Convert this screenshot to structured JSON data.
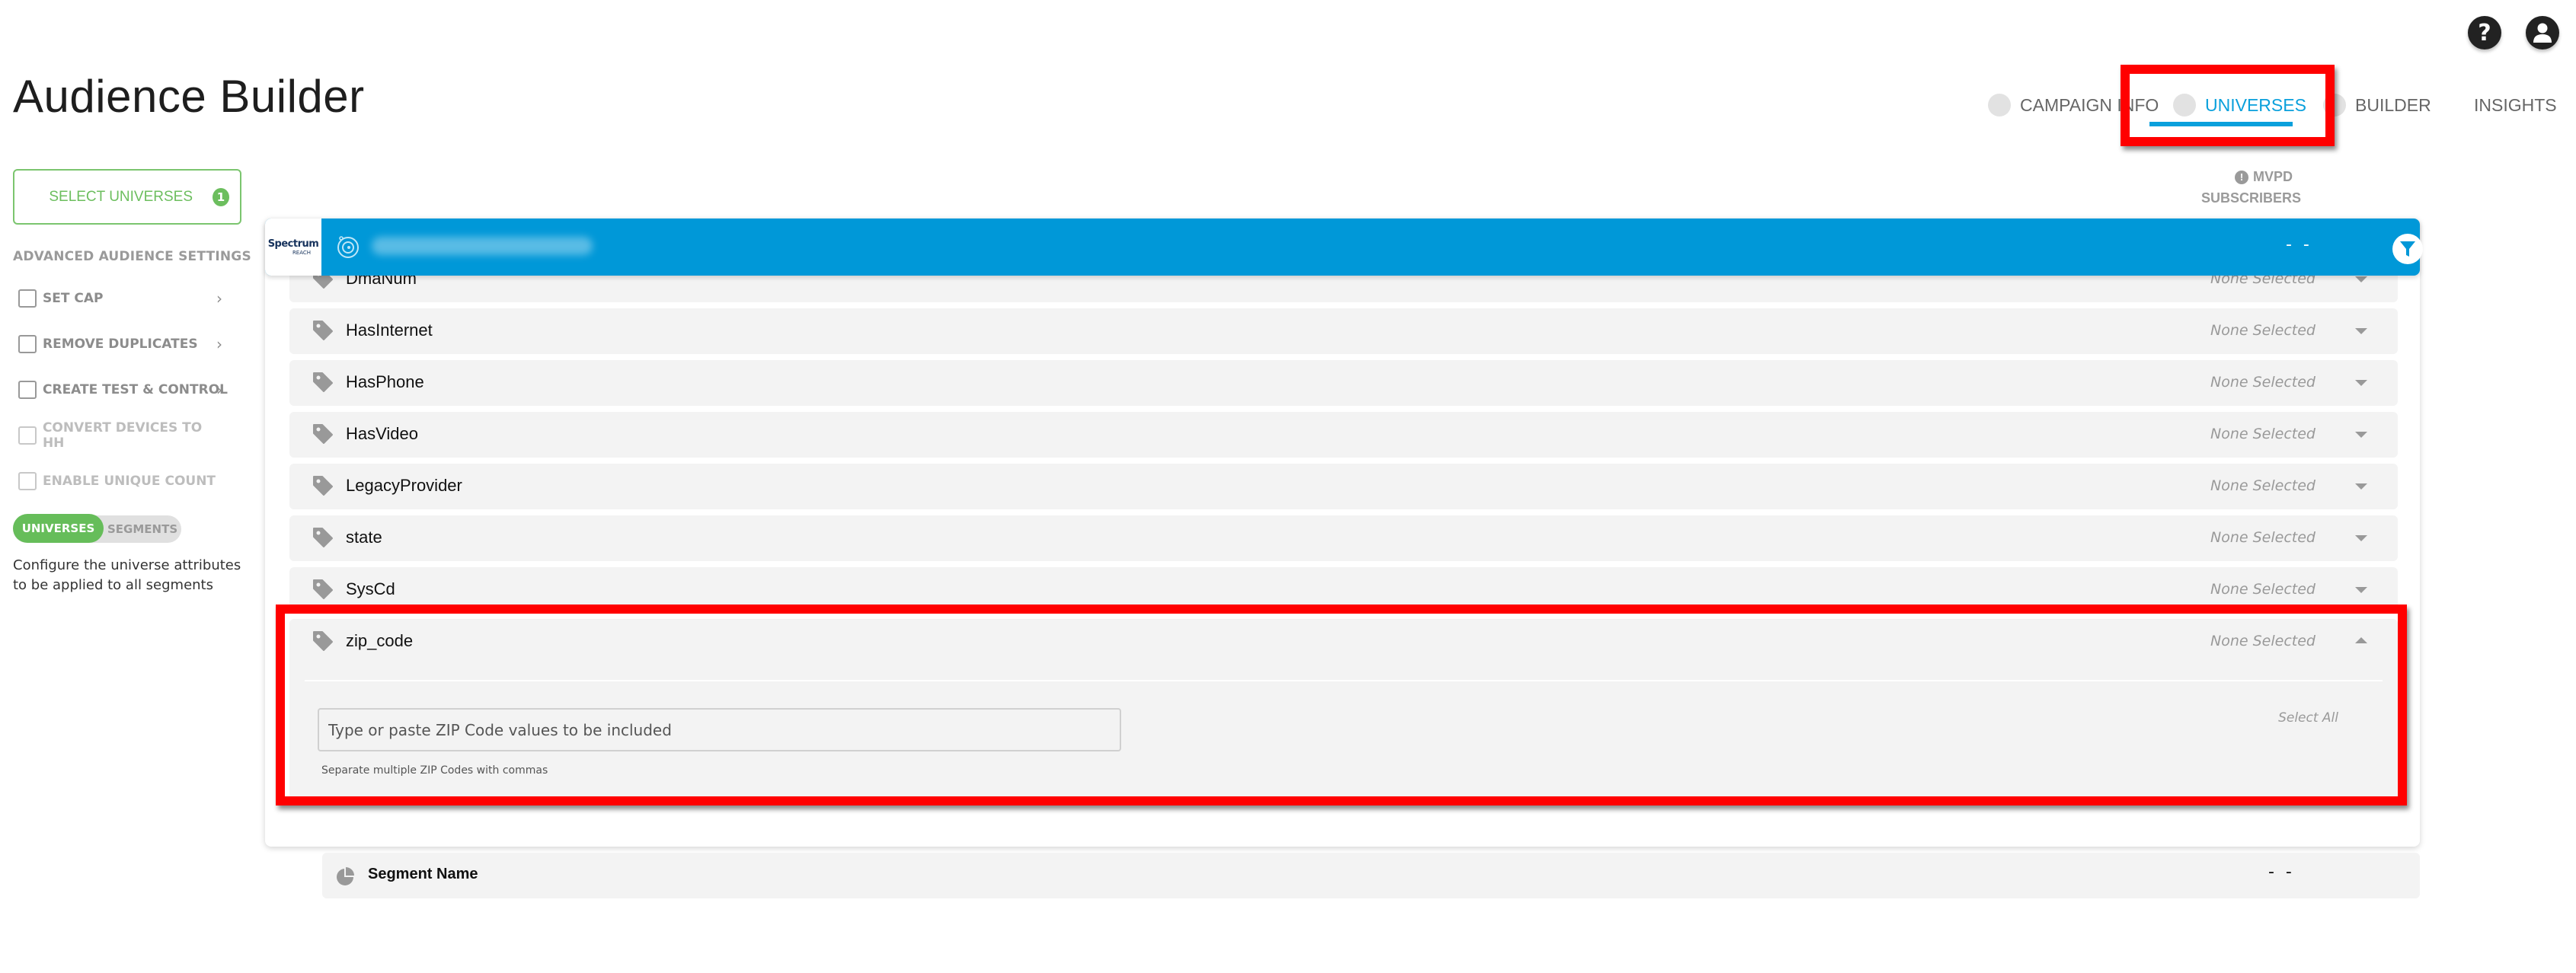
{
  "header": {
    "title": "Audience Builder",
    "help_icon": "help-circle-icon",
    "user_icon": "user-account-icon"
  },
  "steps": [
    {
      "label": "CAMPAIGN INFO",
      "active": false
    },
    {
      "label": "UNIVERSES",
      "active": true
    },
    {
      "label": "BUILDER",
      "active": false
    },
    {
      "label": "INSIGHTS",
      "active": false
    }
  ],
  "colors": {
    "accent_blue": "#0098d8",
    "active_step": "#0aa0dc",
    "green": "#66bd5a",
    "highlight_red": "#ff0000"
  },
  "sidebar": {
    "select_universes": {
      "label": "SELECT UNIVERSES",
      "badge": "1"
    },
    "advanced_title": "ADVANCED AUDIENCE SETTINGS",
    "settings": [
      {
        "label": "SET CAP",
        "checked": false,
        "enabled": true,
        "has_arrow": true
      },
      {
        "label": "REMOVE DUPLICATES",
        "checked": false,
        "enabled": true,
        "has_arrow": true
      },
      {
        "label": "CREATE TEST & CONTROL",
        "checked": false,
        "enabled": true,
        "has_arrow": true
      },
      {
        "label": "CONVERT DEVICES TO HH",
        "checked": false,
        "enabled": false,
        "has_arrow": false
      },
      {
        "label": "ENABLE UNIQUE COUNT",
        "checked": false,
        "enabled": false,
        "has_arrow": false
      }
    ],
    "toggle": {
      "on_label": "UNIVERSES",
      "off_label": "SEGMENTS",
      "selected": "UNIVERSES"
    },
    "description": "Configure the universe attributes to be applied to all segments"
  },
  "main": {
    "column_header": {
      "line1": "MVPD",
      "line2": "SUBSCRIBERS"
    },
    "universe": {
      "logo_line1": "Spectrum",
      "logo_line2": "REACH",
      "name": "Spectrum - Universe zipcode",
      "count": "- -"
    },
    "attributes": [
      {
        "name": "DmaNum",
        "selection": "None Selected",
        "expanded": false
      },
      {
        "name": "HasInternet",
        "selection": "None Selected",
        "expanded": false
      },
      {
        "name": "HasPhone",
        "selection": "None Selected",
        "expanded": false
      },
      {
        "name": "HasVideo",
        "selection": "None Selected",
        "expanded": false
      },
      {
        "name": "LegacyProvider",
        "selection": "None Selected",
        "expanded": false
      },
      {
        "name": "state",
        "selection": "None Selected",
        "expanded": false
      },
      {
        "name": "SysCd",
        "selection": "None Selected",
        "expanded": false
      },
      {
        "name": "zip_code",
        "selection": "None Selected",
        "expanded": true
      }
    ],
    "zip_panel": {
      "input_value": "",
      "placeholder": "Type or paste ZIP Code values to be included",
      "help_text": "Separate multiple ZIP Codes with commas",
      "select_all": "Select All"
    },
    "segment": {
      "name": "Segment Name",
      "count": "- -"
    }
  }
}
